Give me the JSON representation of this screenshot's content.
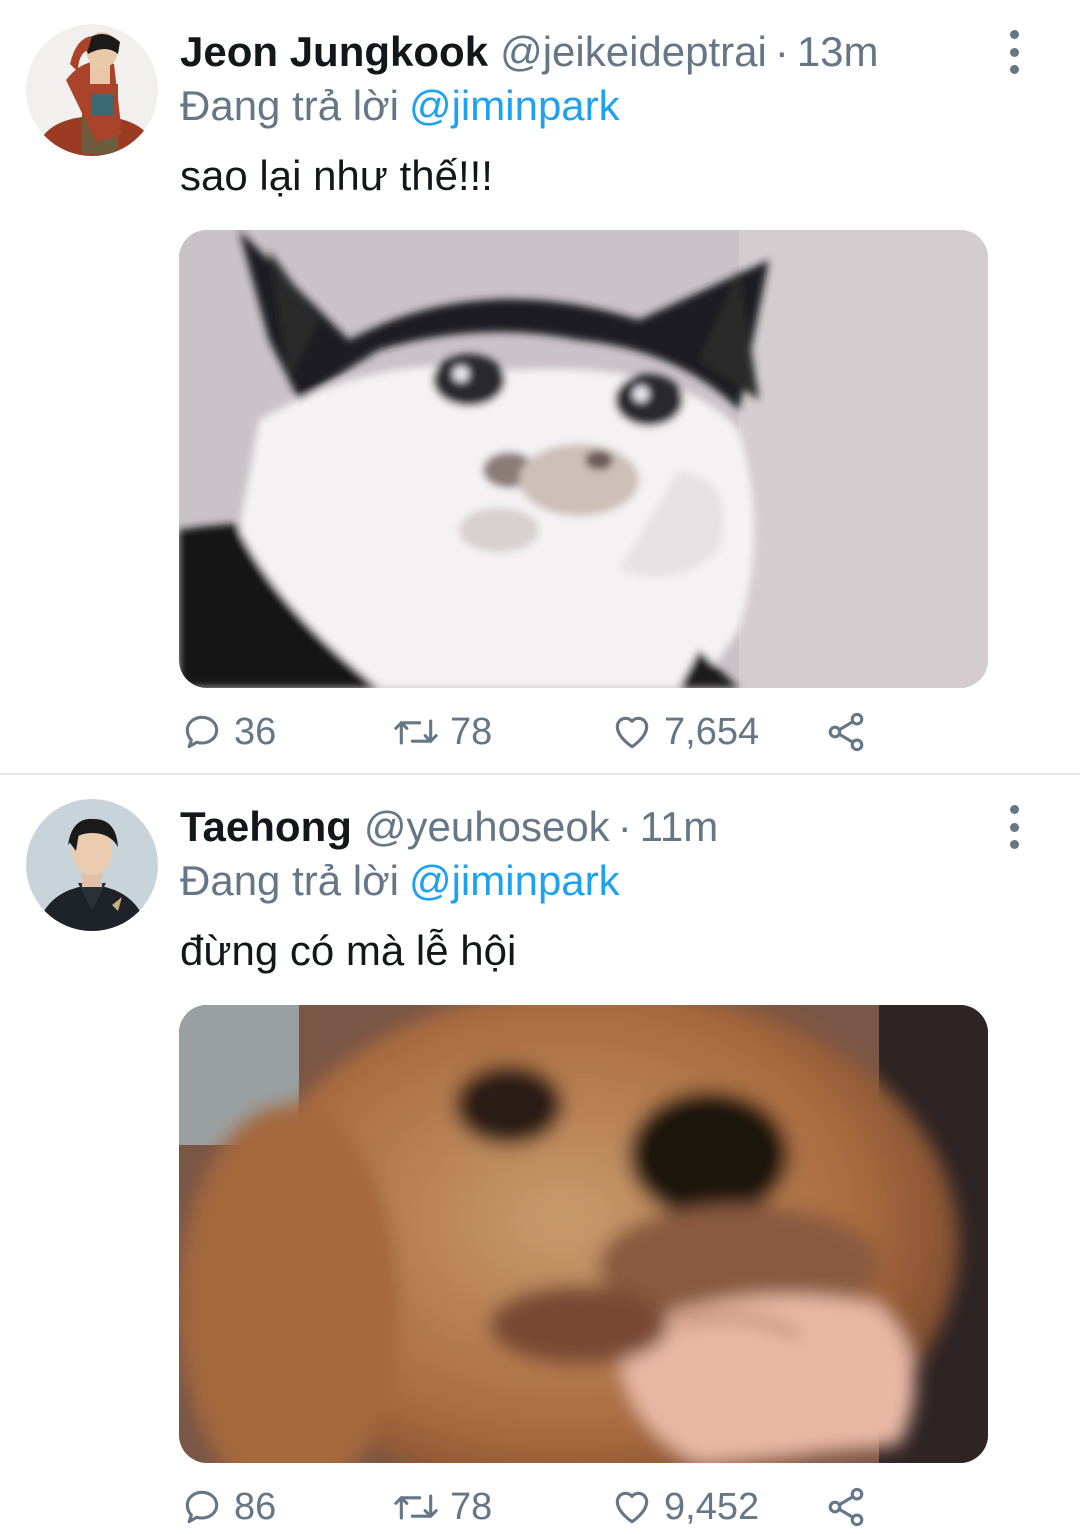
{
  "tweets": [
    {
      "name": "Jeon Jungkook",
      "handle": "@jeikeideptrai",
      "separator": "·",
      "time": "13m",
      "reply_prefix": "Đang trả lời",
      "reply_to": "@jiminpark",
      "text": "sao lại như thế!!!",
      "media_description": "crying-cat-meme",
      "stats": {
        "replies": "36",
        "retweets": "78",
        "likes": "7,654"
      }
    },
    {
      "name": "Taehong",
      "handle": "@yeuhoseok",
      "separator": "·",
      "time": "11m",
      "reply_prefix": "Đang trả lời",
      "reply_to": "@jiminpark",
      "text": "đừng có mà lễ hội",
      "media_description": "dog-biting-hand-meme",
      "stats": {
        "replies": "86",
        "retweets": "78",
        "likes": "9,452"
      }
    }
  ],
  "icons": {
    "reply": "comment-bubble-icon",
    "retweet": "retweet-icon",
    "like": "heart-icon",
    "share": "share-icon",
    "more": "more-vertical-icon"
  },
  "colors": {
    "text": "#14171a",
    "secondary": "#657786",
    "link": "#1da1f2",
    "divider": "#e1e8ed"
  }
}
